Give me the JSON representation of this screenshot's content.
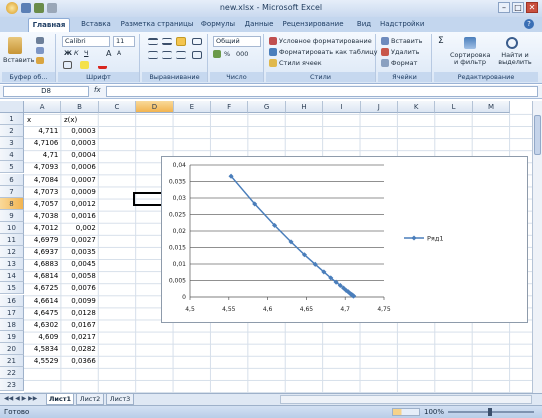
{
  "window": {
    "title": "new.xlsx - Microsoft Excel",
    "controls": [
      "–",
      "□",
      "✕"
    ]
  },
  "tabs": [
    "Главная",
    "Вставка",
    "Разметка страницы",
    "Формулы",
    "Данные",
    "Рецензирование",
    "Вид",
    "Надстройки"
  ],
  "ribbon": {
    "clipboard": {
      "paste": "Вставить",
      "label": "Буфер об..."
    },
    "font": {
      "name": "Calibri",
      "size": "11",
      "bold": "Ж",
      "italic": "К",
      "underline": "Ч",
      "grow": "A",
      "shrink": "A",
      "label": "Шрифт"
    },
    "alignment": {
      "label": "Выравнивание"
    },
    "number": {
      "format": "Общий",
      "percent": "%",
      "thousands": "000",
      "label": "Число"
    },
    "styles": {
      "conditional": "Условное форматирование",
      "as_table": "Форматировать как таблицу",
      "cell_styles": "Стили ячеек",
      "label": "Стили"
    },
    "cells": {
      "insert": "Вставить",
      "delete": "Удалить",
      "format": "Формат",
      "label": "Ячейки"
    },
    "editing": {
      "sort": "Сортировка и фильтр",
      "find": "Найти и выделить",
      "sigma": "Σ",
      "label": "Редактирование"
    }
  },
  "formula_bar": {
    "name_box": "D8",
    "fx": "fx",
    "value": ""
  },
  "columns": [
    "A",
    "B",
    "C",
    "D",
    "E",
    "F",
    "G",
    "H",
    "I",
    "J",
    "K",
    "L",
    "M"
  ],
  "selected_column": "D",
  "selected_row": "8",
  "rows": [
    "1",
    "2",
    "3",
    "4",
    "5",
    "6",
    "7",
    "8",
    "9",
    "10",
    "11",
    "12",
    "13",
    "14",
    "15",
    "16",
    "17",
    "18",
    "19",
    "20",
    "21",
    "22",
    "23"
  ],
  "cells": {
    "header_a": "x",
    "header_b": "z(x)",
    "a": [
      "4,711",
      "4,7106",
      "4,71",
      "4,7093",
      "4,7084",
      "4,7073",
      "4,7057",
      "4,7038",
      "4,7012",
      "4,6979",
      "4,6937",
      "4,6883",
      "4,6814",
      "4,6725",
      "4,6614",
      "4,6475",
      "4,6302",
      "4,609",
      "4,5834",
      "4,5529"
    ],
    "b": [
      "0,0003",
      "0,0003",
      "0,0004",
      "0,0006",
      "0,0007",
      "0,0009",
      "0,0012",
      "0,0016",
      "0,002",
      "0,0027",
      "0,0035",
      "0,0045",
      "0,0058",
      "0,0076",
      "0,0099",
      "0,0128",
      "0,0167",
      "0,0217",
      "0,0282",
      "0,0366"
    ]
  },
  "chart_data": {
    "type": "line",
    "title": "",
    "xlabel": "",
    "ylabel": "",
    "xlim": [
      4.5,
      4.75
    ],
    "ylim": [
      0,
      0.04
    ],
    "x_ticks": [
      "4,5",
      "4,55",
      "4,6",
      "4,65",
      "4,7",
      "4,75"
    ],
    "y_ticks": [
      "0",
      "0,005",
      "0,01",
      "0,015",
      "0,02",
      "0,025",
      "0,03",
      "0,035",
      "0,04"
    ],
    "grid": "horizontal",
    "legend": "right",
    "series": [
      {
        "name": "Ряд1",
        "color": "#4a7ebb",
        "x": [
          4.711,
          4.7106,
          4.71,
          4.7093,
          4.7084,
          4.7073,
          4.7057,
          4.7038,
          4.7012,
          4.6979,
          4.6937,
          4.6883,
          4.6814,
          4.6725,
          4.6614,
          4.6475,
          4.6302,
          4.609,
          4.5834,
          4.5529
        ],
        "y": [
          0.0003,
          0.0003,
          0.0004,
          0.0006,
          0.0007,
          0.0009,
          0.0012,
          0.0016,
          0.002,
          0.0027,
          0.0035,
          0.0045,
          0.0058,
          0.0076,
          0.0099,
          0.0128,
          0.0167,
          0.0217,
          0.0282,
          0.0366
        ]
      }
    ]
  },
  "sheets": [
    "Лист1",
    "Лист2",
    "Лист3"
  ],
  "status": {
    "ready": "Готово",
    "zoom": "100%"
  }
}
